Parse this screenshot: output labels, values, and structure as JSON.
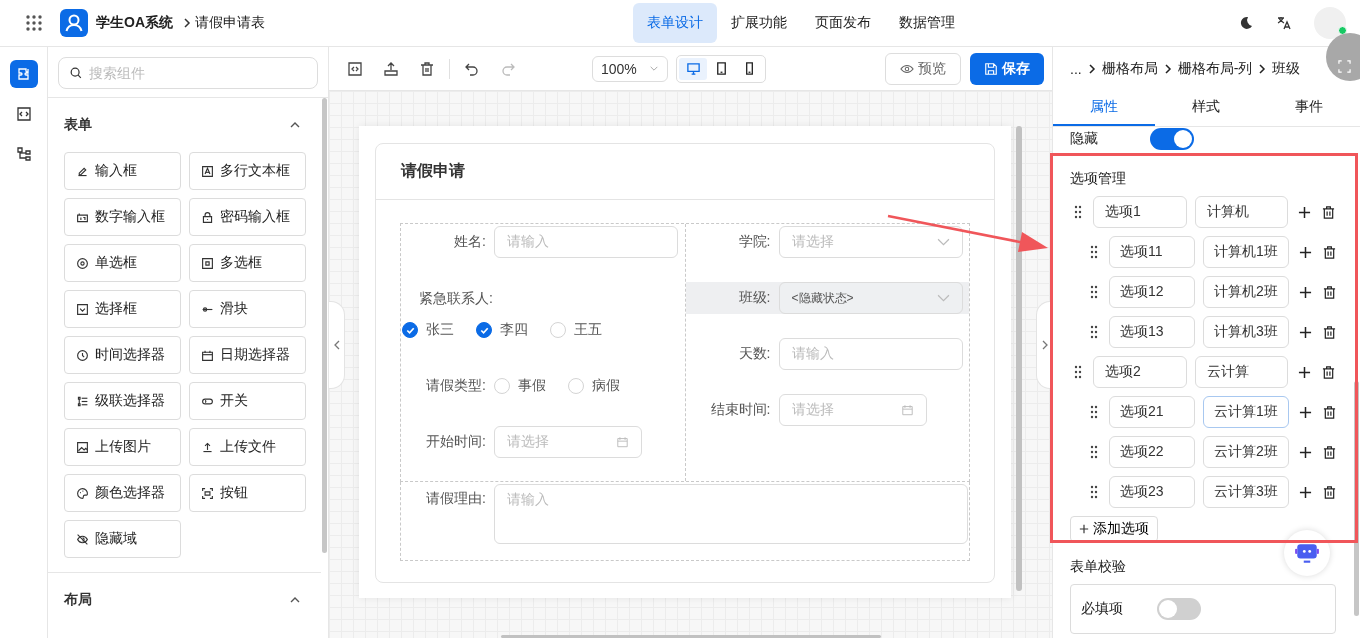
{
  "header": {
    "app_title": "学生OA系统",
    "breadcrumb": "请假申请表",
    "nav": [
      {
        "label": "表单设计",
        "selected": true
      },
      {
        "label": "扩展功能",
        "selected": false
      },
      {
        "label": "页面发布",
        "selected": false
      },
      {
        "label": "数据管理",
        "selected": false
      }
    ],
    "user": {
      "online": true
    }
  },
  "rail": [
    {
      "kind": "components",
      "selected": true
    },
    {
      "kind": "code",
      "selected": false
    },
    {
      "kind": "tree",
      "selected": false
    }
  ],
  "components": {
    "search": {
      "placeholder": "搜索组件"
    },
    "sections": [
      {
        "title": "表单",
        "expanded": true,
        "items": [
          {
            "label": "输入框",
            "kind": "input"
          },
          {
            "label": "多行文本框",
            "kind": "textarea"
          },
          {
            "label": "数字输入框",
            "kind": "number"
          },
          {
            "label": "密码输入框",
            "kind": "password"
          },
          {
            "label": "单选框",
            "kind": "radio"
          },
          {
            "label": "多选框",
            "kind": "checkbox"
          },
          {
            "label": "选择框",
            "kind": "select"
          },
          {
            "label": "滑块",
            "kind": "slider"
          },
          {
            "label": "时间选择器",
            "kind": "time"
          },
          {
            "label": "日期选择器",
            "kind": "date"
          },
          {
            "label": "级联选择器",
            "kind": "cascader"
          },
          {
            "label": "开关",
            "kind": "switch"
          },
          {
            "label": "上传图片",
            "kind": "image"
          },
          {
            "label": "上传文件",
            "kind": "upload"
          },
          {
            "label": "颜色选择器",
            "kind": "color"
          },
          {
            "label": "按钮",
            "kind": "button"
          },
          {
            "label": "隐藏域",
            "kind": "hidden"
          }
        ]
      },
      {
        "title": "布局",
        "expanded": true
      }
    ]
  },
  "toolbar": {
    "zoom": "100%",
    "devices": [
      {
        "kind": "desktop",
        "selected": true
      },
      {
        "kind": "tablet",
        "selected": false
      },
      {
        "kind": "phone",
        "selected": false
      }
    ],
    "preview": "预览",
    "save": "保存"
  },
  "form": {
    "title": "请假申请",
    "left": [
      {
        "kind": "input",
        "label": "姓名:",
        "placeholder": "请输入"
      },
      {
        "kind": "checkbox",
        "label": "紧急联系人:",
        "options": [
          {
            "label": "张三",
            "checked": true
          },
          {
            "label": "李四",
            "checked": true
          },
          {
            "label": "王五",
            "checked": false
          }
        ]
      },
      {
        "kind": "radio",
        "label": "请假类型:",
        "options": [
          {
            "label": "事假",
            "selected": false
          },
          {
            "label": "病假",
            "selected": false
          }
        ]
      },
      {
        "kind": "date",
        "label": "开始时间:",
        "placeholder": "请选择"
      }
    ],
    "right": [
      {
        "kind": "select",
        "label": "学院:",
        "placeholder": "请选择",
        "selected": false
      },
      {
        "kind": "select",
        "label": "班级:",
        "value": "<隐藏状态>",
        "selected": true
      },
      {
        "kind": "input",
        "label": "天数:",
        "placeholder": "请输入"
      },
      {
        "kind": "date",
        "label": "结束时间:",
        "placeholder": "请选择"
      }
    ],
    "reason": {
      "label": "请假理由:",
      "placeholder": "请输入"
    }
  },
  "properties": {
    "breadcrumb": [
      "...",
      "栅格布局",
      "栅格布局-列",
      "班级"
    ],
    "tabs": [
      {
        "label": "属性",
        "selected": true
      },
      {
        "label": "样式",
        "selected": false
      },
      {
        "label": "事件",
        "selected": false
      }
    ],
    "hidden": {
      "label": "隐藏",
      "on": true
    },
    "options_title": "选项管理",
    "options": [
      {
        "label": "选项1",
        "value": "计算机",
        "focused": false,
        "children": [
          {
            "label": "选项11",
            "value": "计算机1班",
            "focused": false
          },
          {
            "label": "选项12",
            "value": "计算机2班",
            "focused": false
          },
          {
            "label": "选项13",
            "value": "计算机3班",
            "focused": false
          }
        ]
      },
      {
        "label": "选项2",
        "value": "云计算",
        "focused": false,
        "children": [
          {
            "label": "选项21",
            "value": "云计算1班",
            "focused": true
          },
          {
            "label": "选项22",
            "value": "云计算2班",
            "focused": false
          },
          {
            "label": "选项23",
            "value": "云计算3班",
            "focused": false
          }
        ]
      }
    ],
    "add_option": "添加选项",
    "validation_title": "表单校验",
    "required": {
      "label": "必填项",
      "on": false
    }
  }
}
